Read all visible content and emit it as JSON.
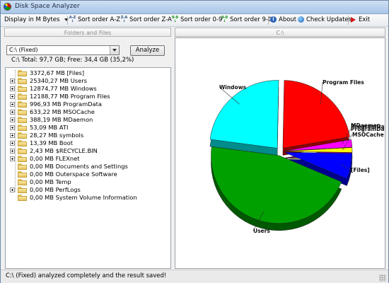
{
  "window": {
    "title": "Disk Space Analyzer"
  },
  "toolbar": {
    "display_mode": "Display in M Bytes",
    "sort_az": "Sort order A-Z",
    "sort_za": "Sort order Z-A",
    "sort_09": "Sort order 0-9",
    "sort_90": "Sort order 9-0",
    "about": "About",
    "check_updates": "Check Updates",
    "exit": "Exit"
  },
  "left_pane": {
    "header": "Folders and Files",
    "drive_select": "C:\\ (Fixed)",
    "analyze_label": "Analyze",
    "summary": "C:\\ Total: 97,7 GB; Free: 34,4 GB (35,2%)"
  },
  "right_pane": {
    "header": "C:\\"
  },
  "tree": [
    {
      "label": "3372,67 MB [Files]",
      "expandable": false
    },
    {
      "label": "25340,27 MB Users",
      "expandable": true
    },
    {
      "label": "12874,77 MB Windows",
      "expandable": true
    },
    {
      "label": "12188,77 MB Program Files",
      "expandable": true
    },
    {
      "label": "996,93 MB ProgramData",
      "expandable": true
    },
    {
      "label": "633,22 MB MSOCache",
      "expandable": true
    },
    {
      "label": "388,19 MB MDaemon",
      "expandable": true
    },
    {
      "label": "53,09 MB ATI",
      "expandable": true
    },
    {
      "label": "28,27 MB symbols",
      "expandable": true
    },
    {
      "label": "13,39 MB Boot",
      "expandable": true
    },
    {
      "label": "2,43 MB $RECYCLE.BIN",
      "expandable": true
    },
    {
      "label": "0,00 MB FLEXnet",
      "expandable": true
    },
    {
      "label": "0,00 MB Documents and Settings",
      "expandable": false
    },
    {
      "label": "0,00 MB Outerspace Software",
      "expandable": false
    },
    {
      "label": "0,00 MB Temp",
      "expandable": false
    },
    {
      "label": "0,00 MB PerfLogs",
      "expandable": true
    },
    {
      "label": "0,00 MB System Volume Information",
      "expandable": false
    }
  ],
  "pie": {
    "slices": [
      {
        "label": "Program Files",
        "value": 12188.77,
        "color": "#ff0000"
      },
      {
        "label": "ProgramData",
        "value": 996.93,
        "color": "#ff00ff"
      },
      {
        "label": "MSOCache",
        "value": 633.22,
        "color": "#ffff00"
      },
      {
        "label": "[Files]",
        "value": 3372.67,
        "color": "#0000ff"
      },
      {
        "label": "Users",
        "value": 25340.27,
        "color": "#00a000"
      },
      {
        "label": "Windows",
        "value": 12874.77,
        "color": "#00ffff"
      }
    ],
    "overlap_labels": [
      "MDaemon",
      "ProgramData"
    ]
  },
  "status": {
    "text": "C:\\ (Fixed) analyzed completely and the result saved!"
  },
  "colors": {
    "tree_folder": "#e6c35d",
    "title_gradient_top": "#cfe0f3",
    "title_gradient_bottom": "#a9c6e8"
  },
  "icons": [
    "pie-chart-icon",
    "sort-az-icon",
    "sort-za-icon",
    "sort-09-icon",
    "sort-90-icon",
    "about-icon",
    "check-updates-icon",
    "exit-icon",
    "folder-icon"
  ]
}
